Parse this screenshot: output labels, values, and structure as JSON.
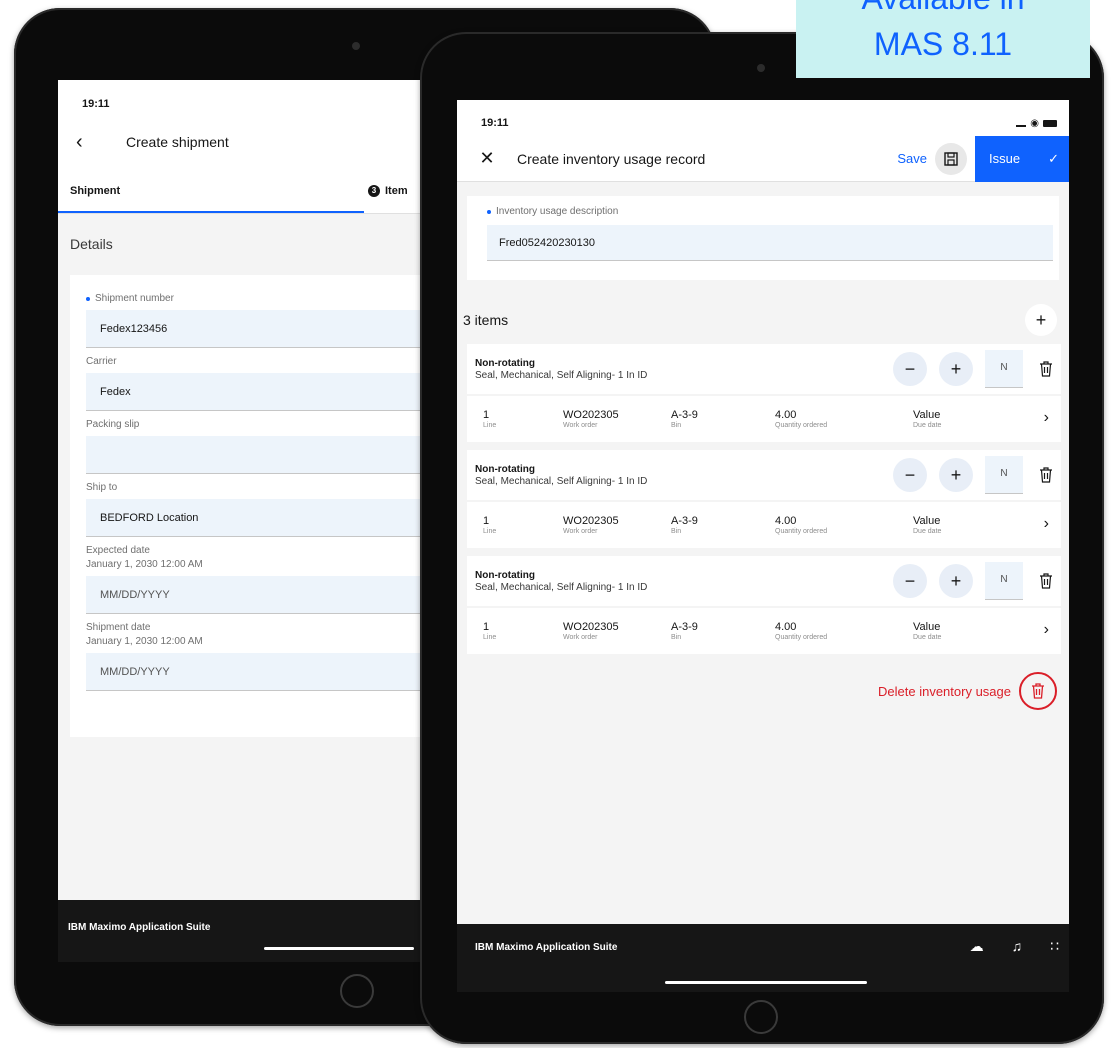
{
  "badge": {
    "line1": "Available in",
    "line2": "MAS 8.11"
  },
  "back_screen": {
    "time": "19:11",
    "title": "Create shipment",
    "tab_shipment": "Shipment",
    "tab_items_badge": "3",
    "tab_items": "Item",
    "section": "Details",
    "fields": [
      {
        "label": "Shipment number",
        "required": true,
        "value": "Fedex123456"
      },
      {
        "label": "Carrier",
        "value": "Fedex"
      },
      {
        "label": "Packing slip",
        "value": ""
      },
      {
        "label": "Ship to",
        "value": "BEDFORD Location"
      },
      {
        "label": "Expected date",
        "sub": "January 1, 2030 12:00 AM",
        "value": "MM/DD/YYYY"
      },
      {
        "label": "Shipment date",
        "sub": "January 1, 2030 12:00 AM",
        "value": "MM/DD/YYYY"
      }
    ],
    "footer": "IBM Maximo Application Suite"
  },
  "front_screen": {
    "time": "19:11",
    "title": "Create inventory usage record",
    "save_label": "Save",
    "issue_label": "Issue",
    "desc_label": "Inventory usage description",
    "desc_value": "Fred052420230130",
    "items_count": "3 items",
    "items": [
      {
        "type": "Non-rotating",
        "desc": "Seal, Mechanical, Self Aligning- 1 In ID",
        "qty_placeholder": "N",
        "line": "1",
        "line_label": "Line",
        "wo": "WO202305",
        "wo_label": "Work order",
        "bin": "A-3-9",
        "bin_label": "Bin",
        "qty": "4.00",
        "qty_label": "Quantity ordered",
        "due": "Value",
        "due_label": "Due date"
      },
      {
        "type": "Non-rotating",
        "desc": "Seal, Mechanical, Self Aligning- 1 In ID",
        "qty_placeholder": "N",
        "line": "1",
        "line_label": "Line",
        "wo": "WO202305",
        "wo_label": "Work order",
        "bin": "A-3-9",
        "bin_label": "Bin",
        "qty": "4.00",
        "qty_label": "Quantity ordered",
        "due": "Value",
        "due_label": "Due date"
      },
      {
        "type": "Non-rotating",
        "desc": "Seal, Mechanical, Self Aligning- 1 In ID",
        "qty_placeholder": "N",
        "line": "1",
        "line_label": "Line",
        "wo": "WO202305",
        "wo_label": "Work order",
        "bin": "A-3-9",
        "bin_label": "Bin",
        "qty": "4.00",
        "qty_label": "Quantity ordered",
        "due": "Value",
        "due_label": "Due date"
      }
    ],
    "delete_label": "Delete inventory usage",
    "footer": "IBM Maximo Application Suite"
  },
  "colors": {
    "accent": "#0f62fe",
    "danger": "#da1e28",
    "badge_bg": "#c9f2f2",
    "footer_bg": "#161616"
  }
}
